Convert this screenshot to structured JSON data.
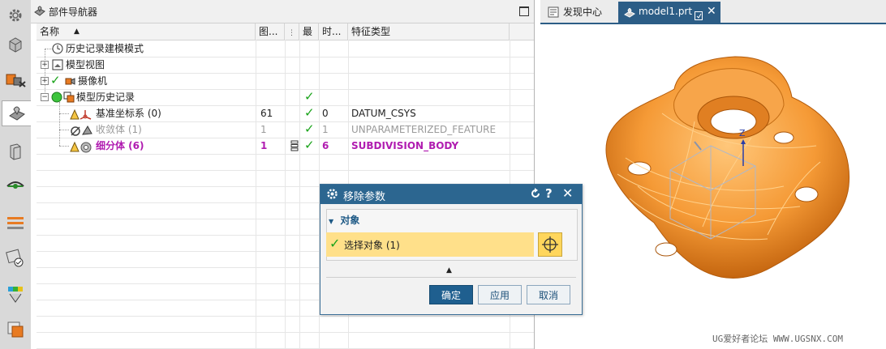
{
  "left_strip": {
    "icons": [
      "settings-icon",
      "part-cube-icon",
      "assembly-icon",
      "part-navigator-icon",
      "book-icon",
      "view-eye-icon",
      "history-icon",
      "roles-icon",
      "palette-icon",
      "color-icon"
    ]
  },
  "navigator": {
    "title": "部件导航器",
    "columns": [
      "名称",
      "图...",
      "",
      "最",
      "时...",
      "特征类型"
    ],
    "rows": [
      {
        "name": "历史记录建模模式",
        "col_img": "",
        "col_up": "",
        "col_time": "",
        "col_type": "",
        "style": "normal"
      },
      {
        "name": "模型视图",
        "col_img": "",
        "col_up": "",
        "col_time": "",
        "col_type": "",
        "style": "normal"
      },
      {
        "name": "摄像机",
        "col_img": "",
        "col_up": "",
        "col_time": "",
        "col_type": "",
        "style": "normal"
      },
      {
        "name": "模型历史记录",
        "col_img": "",
        "col_up": "✓",
        "col_time": "",
        "col_type": "",
        "style": "normal"
      },
      {
        "name": "基准坐标系 (0)",
        "col_img": "61",
        "col_up": "✓",
        "col_time": "0",
        "col_type": "DATUM_CSYS",
        "style": "normal"
      },
      {
        "name": "收敛体 (1)",
        "col_img": "1",
        "col_up": "✓",
        "col_time": "1",
        "col_type": "UNPARAMETERIZED_FEATURE",
        "style": "gray"
      },
      {
        "name": "细分体 (6)",
        "col_img": "1",
        "col_up": "✓",
        "col_time": "6",
        "col_type": "SUBDIVISION_BODY",
        "style": "magenta"
      }
    ]
  },
  "graphics": {
    "tabs": [
      "发现中心",
      "model1.prt"
    ],
    "axis_label": "Z",
    "watermark": "UG爱好者论坛 WWW.UGSNX.COM"
  },
  "dialog": {
    "title": "移除参数",
    "group": "对象",
    "select_label": "选择对象 (1)",
    "buttons": {
      "ok": "确定",
      "apply": "应用",
      "cancel": "取消"
    }
  },
  "colors": {
    "accent": "#2c6690",
    "model": "#f5a142",
    "check": "#1aa31a",
    "magenta": "#b01cb0"
  }
}
